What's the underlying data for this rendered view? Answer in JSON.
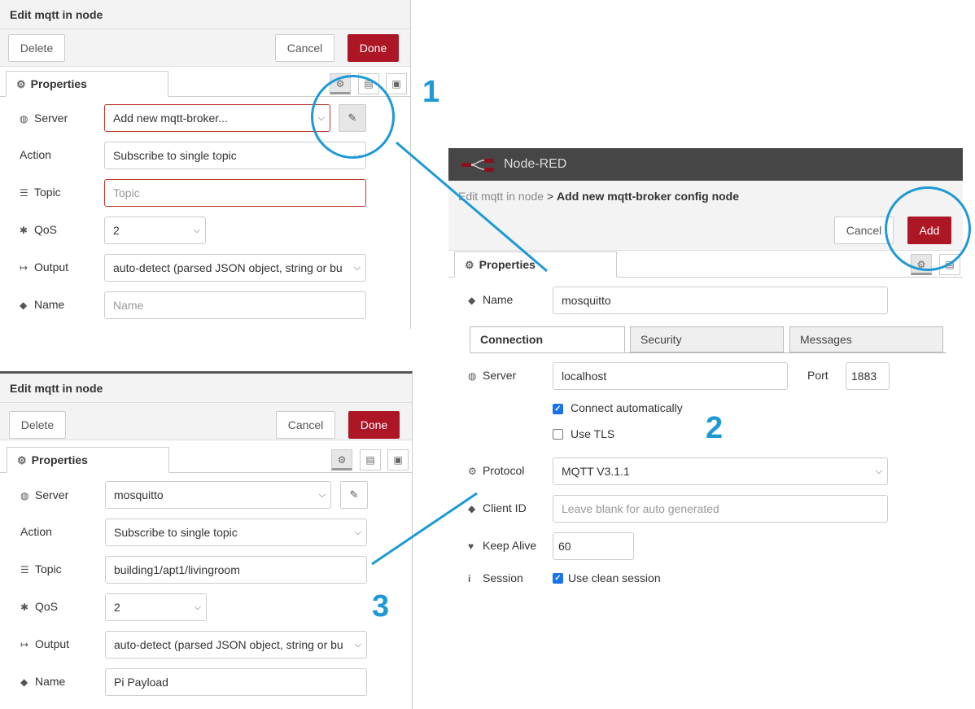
{
  "panel1": {
    "title": "Edit mqtt in node",
    "delete_label": "Delete",
    "cancel_label": "Cancel",
    "done_label": "Done",
    "properties_tab": "Properties",
    "server_label": "Server",
    "server_value": "Add new mqtt-broker...",
    "action_label": "Action",
    "action_value": "Subscribe to single topic",
    "topic_label": "Topic",
    "topic_placeholder": "Topic",
    "qos_label": "QoS",
    "qos_value": "2",
    "output_label": "Output",
    "output_value": "auto-detect (parsed JSON object, string or bu",
    "name_label": "Name",
    "name_placeholder": "Name"
  },
  "panel3": {
    "title": "Edit mqtt in node",
    "delete_label": "Delete",
    "cancel_label": "Cancel",
    "done_label": "Done",
    "properties_tab": "Properties",
    "server_label": "Server",
    "server_value": "mosquitto",
    "action_label": "Action",
    "action_value": "Subscribe to single topic",
    "topic_label": "Topic",
    "topic_value": "building1/apt1/livingroom",
    "qos_label": "QoS",
    "qos_value": "2",
    "output_label": "Output",
    "output_value": "auto-detect (parsed JSON object, string or bu",
    "name_label": "Name",
    "name_value": "Pi Payload"
  },
  "panel2": {
    "app_title": "Node-RED",
    "breadcrumb_parent": "Edit mqtt in node",
    "breadcrumb_sep": ">",
    "breadcrumb_current": "Add new mqtt-broker config node",
    "cancel_label": "Cancel",
    "add_label": "Add",
    "properties_tab": "Properties",
    "name_label": "Name",
    "name_value": "mosquitto",
    "tabs": [
      "Connection",
      "Security",
      "Messages"
    ],
    "server_label": "Server",
    "server_value": "localhost",
    "port_label": "Port",
    "port_value": "1883",
    "connect_auto_label": "Connect automatically",
    "connect_auto_checked": true,
    "use_tls_label": "Use TLS",
    "use_tls_checked": false,
    "protocol_label": "Protocol",
    "protocol_value": "MQTT V3.1.1",
    "client_id_label": "Client ID",
    "client_id_placeholder": "Leave blank for auto generated",
    "keep_alive_label": "Keep Alive",
    "keep_alive_value": "60",
    "session_label": "Session",
    "clean_session_label": "Use clean session",
    "clean_session_checked": true
  },
  "annotations": {
    "one": "1",
    "two": "2",
    "three": "3"
  },
  "colors": {
    "primary_button": "#ad1625",
    "annotation": "#1d9ad6",
    "header_bar": "#464646"
  },
  "icons": [
    "gear-icon",
    "globe-icon",
    "topic-list-icon",
    "qos-icon",
    "output-icon",
    "tag-icon",
    "pencil-icon",
    "heartbeat-icon",
    "info-icon",
    "node-red-logo-icon",
    "description-icon",
    "appearance-icon",
    "chevron-down-icon",
    "checkbox-icon"
  ]
}
